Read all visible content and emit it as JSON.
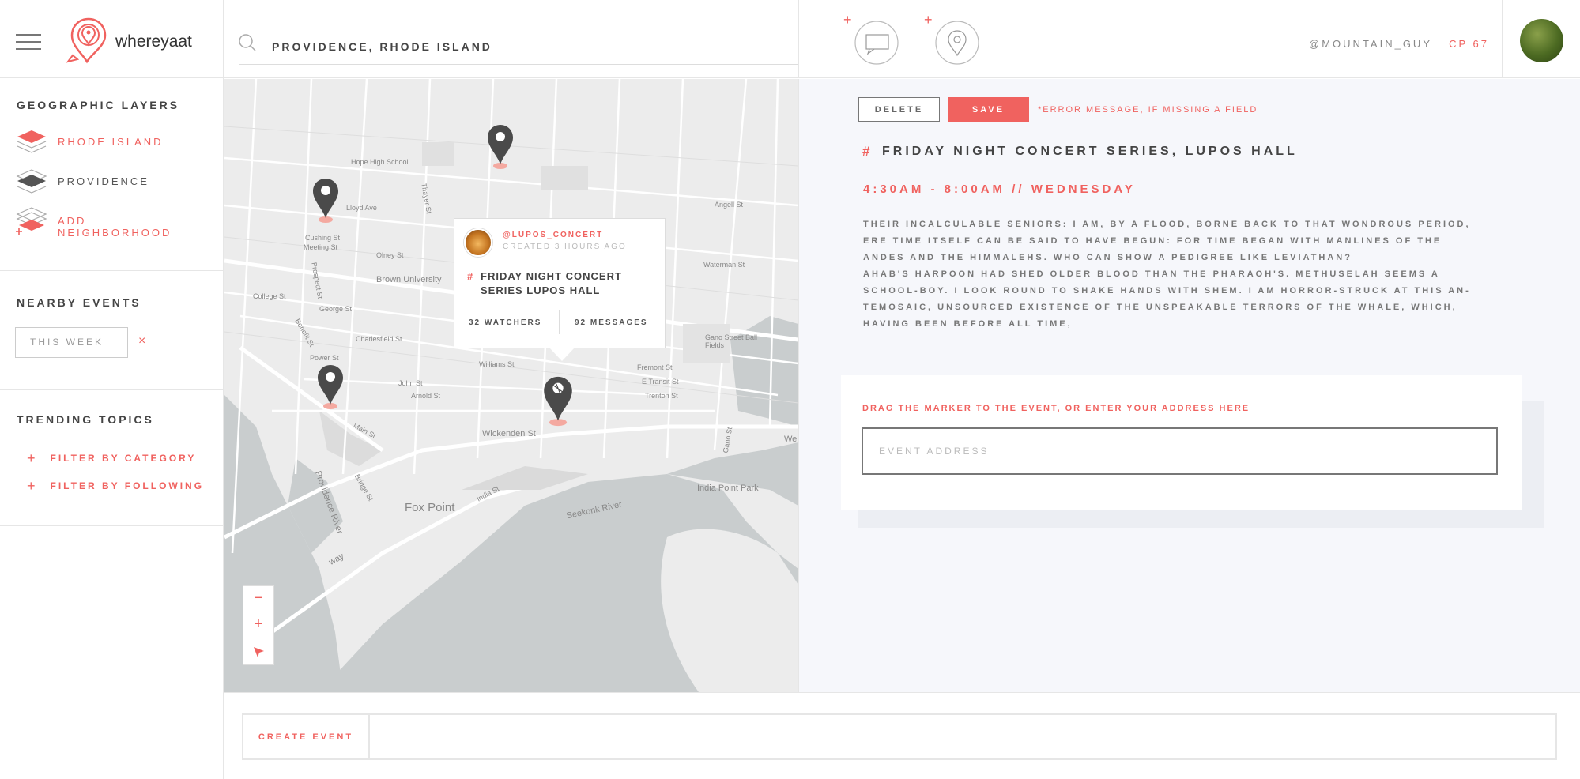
{
  "brand": {
    "name": "whereyaat"
  },
  "sidebar": {
    "layers_title": "GEOGRAPHIC LAYERS",
    "layers": [
      {
        "label": "RHODE ISLAND",
        "color": "#f0625f"
      },
      {
        "label": "PROVIDENCE",
        "color": "#555555"
      },
      {
        "label": "ADD NEIGHBORHOOD",
        "color": "#f0625f"
      }
    ],
    "events_title": "NEARBY EVENTS",
    "events_filter": "THIS WEEK",
    "events_clear": "×",
    "topics_title": "TRENDING TOPICS",
    "filters": [
      {
        "plus": "+",
        "label": "FILTER BY CATEGORY"
      },
      {
        "plus": "+",
        "label": "FILTER BY FOLLOWING"
      }
    ]
  },
  "header": {
    "search_value": "PROVIDENCE, RHODE ISLAND",
    "username": "@MOUNTAIN_GUY",
    "cp": "CP 67",
    "add_plus": "+"
  },
  "map": {
    "labels": {
      "hope_high": "Hope High School",
      "brown": "Brown University",
      "fox_point": "Fox Point",
      "india_point": "India Point Park",
      "seekonk": "Seekonk River",
      "providence_river": "Providence River",
      "gano": "Gano Street Ball Fields",
      "wickenden": "Wickenden St",
      "john": "John St",
      "arnold": "Arnold St",
      "williams": "Williams St",
      "india_st": "India St",
      "main": "Main St",
      "bridge": "Bridge St",
      "george": "George St",
      "college": "College St",
      "power": "Power St",
      "benefit": "Benefit St",
      "charlesfield": "Charlesfield St",
      "fremont": "Fremont St",
      "transit": "E Transit St",
      "trenton": "Trenton St",
      "waterman": "Waterman St",
      "angell": "Angell St",
      "olney": "Olney St",
      "cushing": "Cushing St",
      "meeting": "Meeting St",
      "prospect": "Prospect St",
      "thayer": "Thayer St",
      "lloyd": "Lloyd Ave",
      "gano_st": "Gano St",
      "way": "way",
      "we": "We"
    },
    "popup": {
      "user": "@LUPOS_CONCERT",
      "created": "CREATED 3 HOURS AGO",
      "hash": "#",
      "title": "FRIDAY NIGHT CONCERT SERIES LUPOS HALL",
      "watchers": "32 WATCHERS",
      "messages": "92 MESSAGES"
    },
    "zoom": {
      "minus": "−",
      "plus": "+"
    }
  },
  "detail": {
    "delete_label": "DELETE",
    "save_label": "SAVE",
    "error": "*ERROR MESSAGE, IF MISSING A FIELD",
    "hash": "#",
    "title": "FRIDAY NIGHT CONCERT SERIES, LUPOS HALL",
    "time": "4:30AM - 8:00AM  //  WEDNESDAY",
    "description_lines": [
      "THEIR INCALCULABLE SENIORS: I AM, BY A FLOOD, BORNE BACK TO THAT WONDROUS PERIOD,",
      "ERE TIME ITSELF CAN BE SAID TO HAVE BEGUN: FOR TIME BEGAN WITH MANLINES OF THE",
      "ANDES AND THE HIMMALEHS. WHO CAN SHOW A PEDIGREE LIKE LEVIATHAN?",
      "AHAB'S HARPOON HAD SHED OLDER BLOOD THAN THE PHARAOH'S. METHUSELAH SEEMS A",
      "SCHOOL-BOY. I LOOK ROUND TO SHAKE HANDS WITH SHEM. I AM HORROR-STRUCK AT THIS AN-",
      "TEMOSAIC, UNSOURCED EXISTENCE OF THE UNSPEAKABLE TERRORS OF THE WHALE, WHICH,",
      "HAVING BEEN BEFORE ALL TIME,"
    ],
    "address_label": "DRAG THE MARKER TO THE EVENT, OR ENTER YOUR ADDRESS HERE",
    "address_placeholder": "EVENT ADDRESS"
  },
  "footer": {
    "create_label": "CREATE EVENT"
  },
  "colors": {
    "accent": "#f0625f",
    "panel": "#f6f7fb",
    "pin": "#4a4a4a"
  }
}
